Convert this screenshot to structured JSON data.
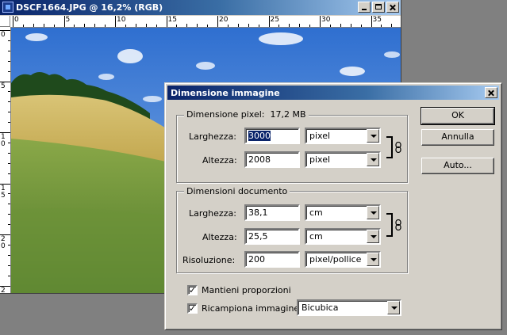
{
  "document": {
    "title": "DSCF1664.JPG @ 16,2% (RGB)",
    "ruler_h_labels": [
      "0",
      "5",
      "10",
      "15",
      "20",
      "25",
      "30",
      "35"
    ],
    "ruler_v_labels": [
      "0",
      "5",
      "1\n0",
      "1\n5",
      "2\n0",
      "2"
    ]
  },
  "dialog": {
    "title": "Dimensione immagine",
    "pixel_group": {
      "title": "Dimensione pixel:",
      "size": "17,2 MB",
      "width_label": "Larghezza:",
      "width_value": "3000",
      "width_unit": "pixel",
      "height_label": "Altezza:",
      "height_value": "2008",
      "height_unit": "pixel"
    },
    "doc_group": {
      "title": "Dimensioni documento",
      "width_label": "Larghezza:",
      "width_value": "38,1",
      "width_unit": "cm",
      "height_label": "Altezza:",
      "height_value": "25,5",
      "height_unit": "cm",
      "res_label": "Risoluzione:",
      "res_value": "200",
      "res_unit": "pixel/pollice"
    },
    "constrain_label": "Mantieni proporzioni",
    "constrain_checked": true,
    "resample_label": "Ricampiona immagine:",
    "resample_checked": true,
    "resample_method": "Bicubica",
    "buttons": {
      "ok": "OK",
      "cancel": "Annulla",
      "auto": "Auto..."
    }
  },
  "colors": {
    "titlebar": "#0a246a",
    "face": "#d4d0c8",
    "selection": "#0a246a"
  }
}
